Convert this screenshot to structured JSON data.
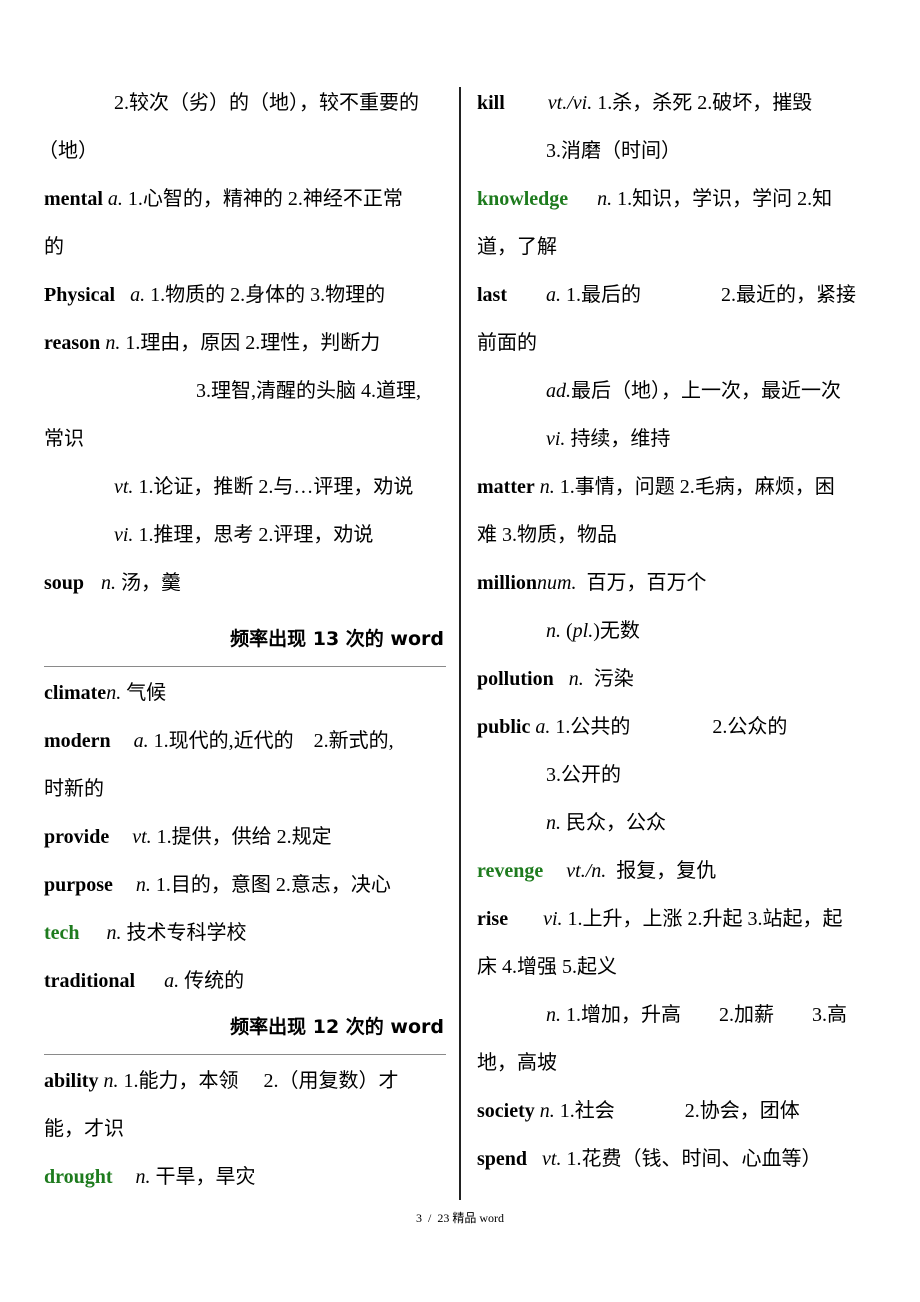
{
  "left_column": {
    "lines": [
      {
        "indent": "       ",
        "text": "2.较次（劣）的（地），较不重要的"
      },
      {
        "text": "（地）"
      },
      {
        "headword": "mental",
        "pos": "a.",
        "text": " 1.心智的，精神的 2.神经不正常"
      },
      {
        "text": "的"
      },
      {
        "headword": "Physical",
        "pos": "a.",
        "text": " 1.物质的 2.身体的 3.物理的"
      },
      {
        "headword": "reason",
        "pos": "n.",
        "text": " 1.理由，原因 2.理性，判断力"
      },
      {
        "text": "3.理智,清醒的头脑 4.道理,"
      },
      {
        "text": "常识"
      },
      {
        "pos": "vt.",
        "text": " 1.论证，推断 2.与…评理，劝说"
      },
      {
        "pos": "vi.",
        "text": " 1.推理，思考 2.评理，劝说"
      },
      {
        "headword": "soup",
        "pos": "n.",
        "text": " 汤，羹"
      }
    ],
    "heading_13": "频率出现 13 次的 word",
    "lines_13": [
      {
        "headword": "climate",
        "pos": "n.",
        "text": " 气候"
      },
      {
        "headword": "modern",
        "pos": "a.",
        "text": " 1.现代的,近代的    2.新式的,"
      },
      {
        "text": "时新的"
      },
      {
        "headword": "provide",
        "pos": "vt.",
        "text": " 1.提供，供给 2.规定"
      },
      {
        "headword": "purpose",
        "pos": "n.",
        "text": " 1.目的，意图 2.意志，决心"
      },
      {
        "headword": "tech",
        "pos": "n.",
        "text": " 技术专科学校",
        "green": true
      },
      {
        "headword": "traditional",
        "pos": "a.",
        "text": " 传统的"
      }
    ],
    "heading_12": "频率出现 12 次的 word",
    "lines_12": [
      {
        "headword": "ability",
        "pos": "n.",
        "text": " 1.能力，本领     2.（用复数）才"
      },
      {
        "text": "能，才识"
      },
      {
        "headword": "drought",
        "pos": "n.",
        "text": " 干旱，旱灾",
        "green": true
      }
    ]
  },
  "right_column": {
    "lines": [
      {
        "headword": "kill",
        "pos": "vt./vi.",
        "text": " 1.杀，杀死 2.破坏，摧毁"
      },
      {
        "text": "3.消磨（时间）"
      },
      {
        "headword": "knowledge",
        "pos": "n.",
        "text": " 1.知识，学识，学问 2.知",
        "green": true
      },
      {
        "text": "道，了解"
      },
      {
        "headword": "last",
        "pos": "a.",
        "text": " 1.最后的",
        "text2": "2.最近的，紧接"
      },
      {
        "text": "前面的"
      },
      {
        "pos": "ad.",
        "text": "最后（地），上一次，最近一次"
      },
      {
        "pos": "vi.",
        "text": " 持续，维持"
      },
      {
        "headword": "matter",
        "pos": "n.",
        "text": " 1.事情，问题 2.毛病，麻烦，困"
      },
      {
        "text": "难 3.物质，物品"
      },
      {
        "headword": "million",
        "pos": "num.",
        "text": "  百万，百万个"
      },
      {
        "pos": "n.",
        "text": " (",
        "italic_mid": "pl.",
        "text_after": ")无数"
      },
      {
        "headword": "pollution",
        "pos": "n.",
        "text": "  污染"
      },
      {
        "headword": "public",
        "pos": "a.",
        "text": " 1.公共的",
        "text2": "2.公众的"
      },
      {
        "text": "3.公开的"
      },
      {
        "pos": "n.",
        "text": " 民众，公众"
      },
      {
        "headword": "revenge",
        "pos": "vt./n.",
        "text": "  报复，复仇",
        "green": true
      },
      {
        "headword": "rise",
        "pos": "vi.",
        "text": " 1.上升，上涨 2.升起 3.站起，起"
      },
      {
        "text": "床 4.增强 5.起义"
      },
      {
        "pos": "n.",
        "text": " 1.增加，升高",
        "text2": "2.加薪",
        "text3": "3.高"
      },
      {
        "text": "地，高坡"
      },
      {
        "headword": "society",
        "pos": "n.",
        "text": " 1.社会",
        "text2": "2.协会，团体"
      },
      {
        "headword": "spend",
        "pos": "vt.",
        "text": " 1.花费（钱、时间、心血等）"
      }
    ]
  },
  "footer": {
    "text": "3  /  23 精品 word"
  },
  "colors": {
    "headword_green": "#1e7b1e",
    "text": "#000000",
    "rule": "#8a8a8a"
  }
}
